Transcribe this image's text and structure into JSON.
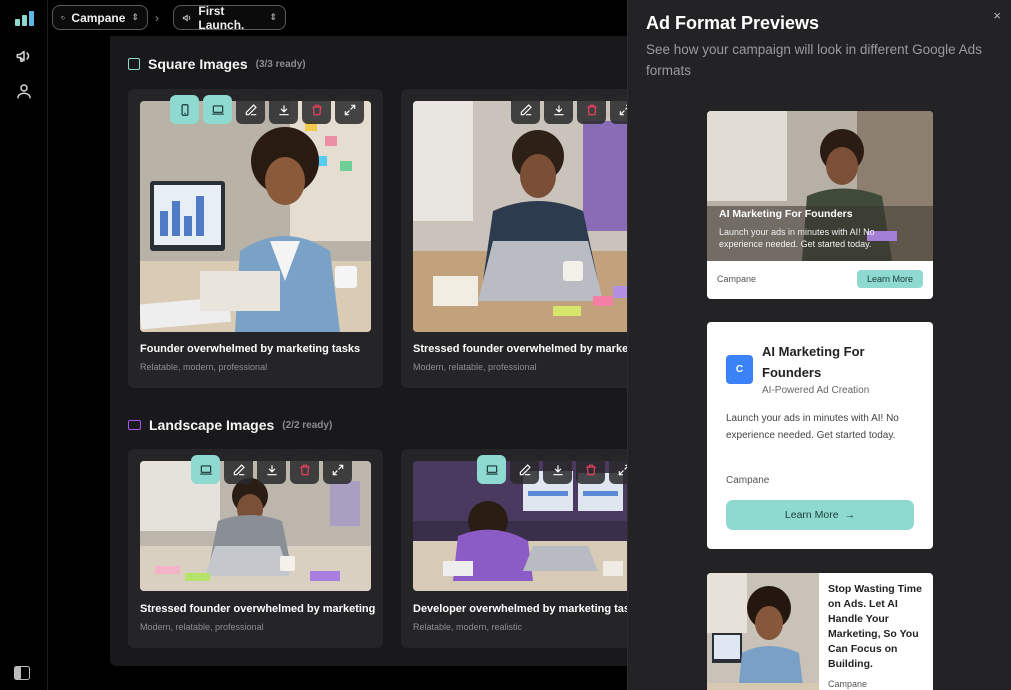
{
  "breadcrumb": {
    "workspace": "Campane",
    "campaign": "First Launch."
  },
  "sections": {
    "square": {
      "title": "Square Images",
      "count": "(3/3 ready)",
      "color": "#8fdad0",
      "cards": [
        {
          "caption": "Founder overwhelmed by marketing tasks",
          "tags": "Relatable, modern, professional"
        },
        {
          "caption": "Stressed founder overwhelmed by marketi",
          "tags": "Modern, relatable, professional"
        }
      ]
    },
    "landscape": {
      "title": "Landscape Images",
      "count": "(2/2 ready)",
      "color": "#a855f7",
      "cards": [
        {
          "caption": "Stressed founder overwhelmed by marketing",
          "tags": "Modern, relatable, professional"
        },
        {
          "caption": "Developer overwhelmed by marketing task",
          "tags": "Relatable, modern, realistic"
        }
      ]
    }
  },
  "panel": {
    "title": "Ad Format Previews",
    "subtitle": "See how your campaign will look in different Google Ads formats",
    "close": "×",
    "ad_overlay": {
      "headline": "AI Marketing For Founders",
      "body": "Launch your ads in minutes with AI! No experience needed. Get started today.",
      "brand": "Campane",
      "cta": "Learn More"
    },
    "ad_card": {
      "logo_letter": "C",
      "headline": "AI Marketing For Founders",
      "subline": "AI-Powered Ad Creation",
      "body": "Launch your ads in minutes with AI! No experience needed. Get started today.",
      "brand": "Campane",
      "cta": "Learn More",
      "cta_arrow": "→"
    },
    "ad_side": {
      "headline": "Stop Wasting Time on Ads. Let AI Handle Your Marketing, So You Can Focus on Building.",
      "brand": "Campane"
    }
  },
  "colors": {
    "accent": "#8fdad0",
    "delete": "#f43f5e",
    "logo_blue": "#3b82f6"
  }
}
